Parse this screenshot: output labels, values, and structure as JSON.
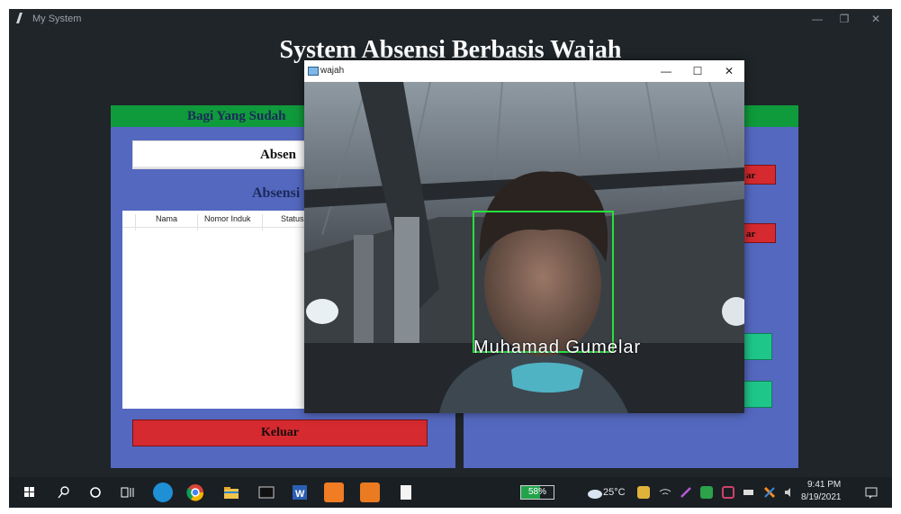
{
  "window": {
    "title": "My System",
    "controls": [
      "—",
      "❐",
      "✕"
    ]
  },
  "app": {
    "heading": "System Absensi Berbasis Wajah"
  },
  "left_panel": {
    "header": "Bagi Yang Sudah",
    "absen_button": "Absen",
    "table_title": "Absensi",
    "columns": [
      "Nama",
      "Nomor Induk",
      "Status"
    ],
    "rows": [],
    "keluar_button": "Keluar"
  },
  "right_panel": {
    "red_buttons": [
      "ar",
      "ar"
    ]
  },
  "camera_window": {
    "title": "wajah",
    "controls": [
      "—",
      "☐",
      "✕"
    ],
    "recognized_name": "Muhamad Gumelar",
    "box_color": "#27e13e"
  },
  "taskbar": {
    "battery_percent": "58%",
    "battery_level": 0.58,
    "weather": "25°C",
    "time": "9:41 PM",
    "date": "8/19/2021",
    "icons": [
      "windows-start-icon",
      "search-icon",
      "cortana-icon",
      "task-view-icon",
      "edge-icon",
      "chrome-icon",
      "file-explorer-icon",
      "terminal-icon",
      "word-icon",
      "xampp-icon",
      "sublime-icon",
      "file-icon"
    ]
  },
  "colors": {
    "panel_blue": "#5468c0",
    "header_green": "#0f9a3b",
    "button_red": "#d42a30",
    "button_green": "#1fc68a",
    "window_bg": "#1f2529"
  }
}
